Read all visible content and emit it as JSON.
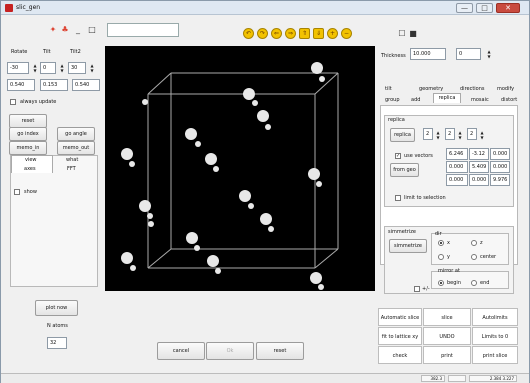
{
  "window": {
    "title": "slic_gen",
    "minimize": "—",
    "maximize": "□",
    "close": "✕"
  },
  "toolbar": {
    "icon_labels": [
      "✦",
      "♣",
      "_",
      "□"
    ],
    "right_icons": [
      "☐",
      "■"
    ]
  },
  "rotate": {
    "label_rotate": "Rotate",
    "label_tilt": "Tilt",
    "label_tilt2": "Tilt2",
    "rot_values": [
      "-30",
      "0",
      "30"
    ],
    "view_values": [
      "0.540",
      "0.153",
      "0.540"
    ],
    "always_update": "always update"
  },
  "left_buttons": {
    "reset": "reset",
    "go_index": "go index",
    "go_angle": "go angle",
    "memo_in": "memo_in",
    "memo_out": "memo_out"
  },
  "view_tabs": {
    "view": "view",
    "axes": "axes",
    "what": "what",
    "fft": "FFT",
    "show": "show"
  },
  "plot_now": "plot now",
  "atoms": {
    "label": "N atoms",
    "value": "32"
  },
  "thickness": {
    "label": "Thickness",
    "value": "10.000",
    "right_value": "0"
  },
  "tabs_top": [
    "tilt",
    "geometry",
    "directions",
    "modify"
  ],
  "tabs_bottom": [
    "group",
    "add",
    "replica",
    "mosaic",
    "distort"
  ],
  "replica": {
    "title": "replica",
    "button": "replica",
    "counts": [
      "2",
      "2",
      "2"
    ],
    "use_vectors": "use vectors",
    "from_geo": "from geo",
    "vectors": [
      [
        "6.246",
        "-3.12",
        "0.000"
      ],
      [
        "0.000",
        "5.409",
        "0.000"
      ],
      [
        "0.000",
        "0.000",
        "9.976"
      ]
    ],
    "limit_to_selection": "limit to selection"
  },
  "symmetrize": {
    "title": "simmetrize",
    "button": "simmetrize",
    "dir_label": "dir",
    "x": "x",
    "z": "z",
    "y": "y",
    "center": "center",
    "mirror_at": "mirror at",
    "begin": "begin",
    "end": "end",
    "plusminus": "+/-"
  },
  "bottom_buttons": {
    "cancel": "cancel",
    "ok": "Ok",
    "reset": "reset"
  },
  "action_grid": [
    [
      "Automatic slice",
      "slice",
      "Autolimits"
    ],
    [
      "fit to lattice xy",
      "UNDO",
      "Limits to 0"
    ],
    [
      "check",
      "print",
      "print slice"
    ]
  ],
  "status": {
    "left": "382.3",
    "right": "2.384 3.227"
  },
  "colors": {
    "accent": "#f2c200",
    "canvas": "#000000",
    "window": "#f0f0f0"
  }
}
